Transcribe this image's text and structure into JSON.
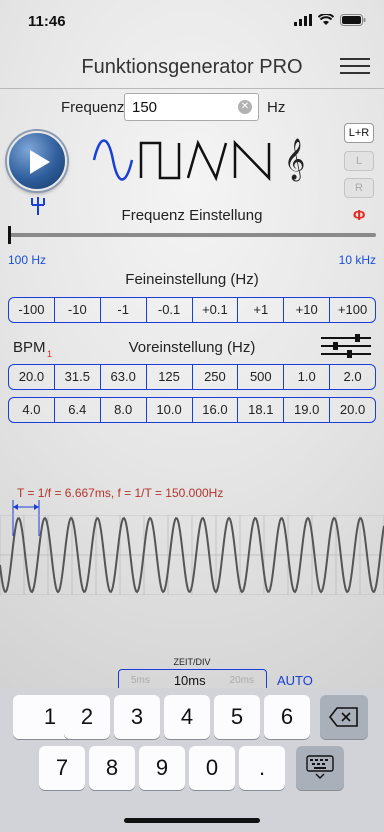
{
  "status_bar": {
    "time": "11:46"
  },
  "nav": {
    "title": "Funktionsgenerator PRO"
  },
  "frequency": {
    "label": "Frequenz",
    "value": "150",
    "unit": "Hz"
  },
  "channels": {
    "lr": "L+R",
    "l": "L",
    "r": "R"
  },
  "freq_setting": {
    "label": "Frequenz Einstellung",
    "phase_symbol": "Φ"
  },
  "slider": {
    "min_label": "100 Hz",
    "max_label": "10 kHz",
    "position_fraction": 0.0
  },
  "fine": {
    "label": "Feineinstellung (Hz)",
    "steps": [
      "-100",
      "-10",
      "-1",
      "-0.1",
      "+0.1",
      "+1",
      "+10",
      "+100"
    ]
  },
  "preset": {
    "bpm_label": "BPM",
    "bpm_sub": "1",
    "label": "Voreinstellung (Hz)",
    "row1": [
      "20.0",
      "31.5",
      "63.0",
      "125",
      "250",
      "500",
      "1.0",
      "2.0"
    ],
    "row2": [
      "4.0",
      "6.4",
      "8.0",
      "10.0",
      "16.0",
      "18.1",
      "19.0",
      "20.0"
    ]
  },
  "scope": {
    "period_text": "T = 1/f = 6.667ms, f = 1/T = 150.000Hz"
  },
  "zeit": {
    "label": "ZEIT/DIV",
    "prev": "5ms",
    "current": "10ms",
    "next": "20ms",
    "auto": "AUTO"
  },
  "keyboard": {
    "keys": [
      "1",
      "2",
      "3",
      "4",
      "5",
      "6",
      "7",
      "8",
      "9",
      "0",
      "."
    ]
  },
  "colors": {
    "accent_blue": "#1a3fd6",
    "phase_red": "#e32a1f",
    "period_text": "#b2352b"
  }
}
